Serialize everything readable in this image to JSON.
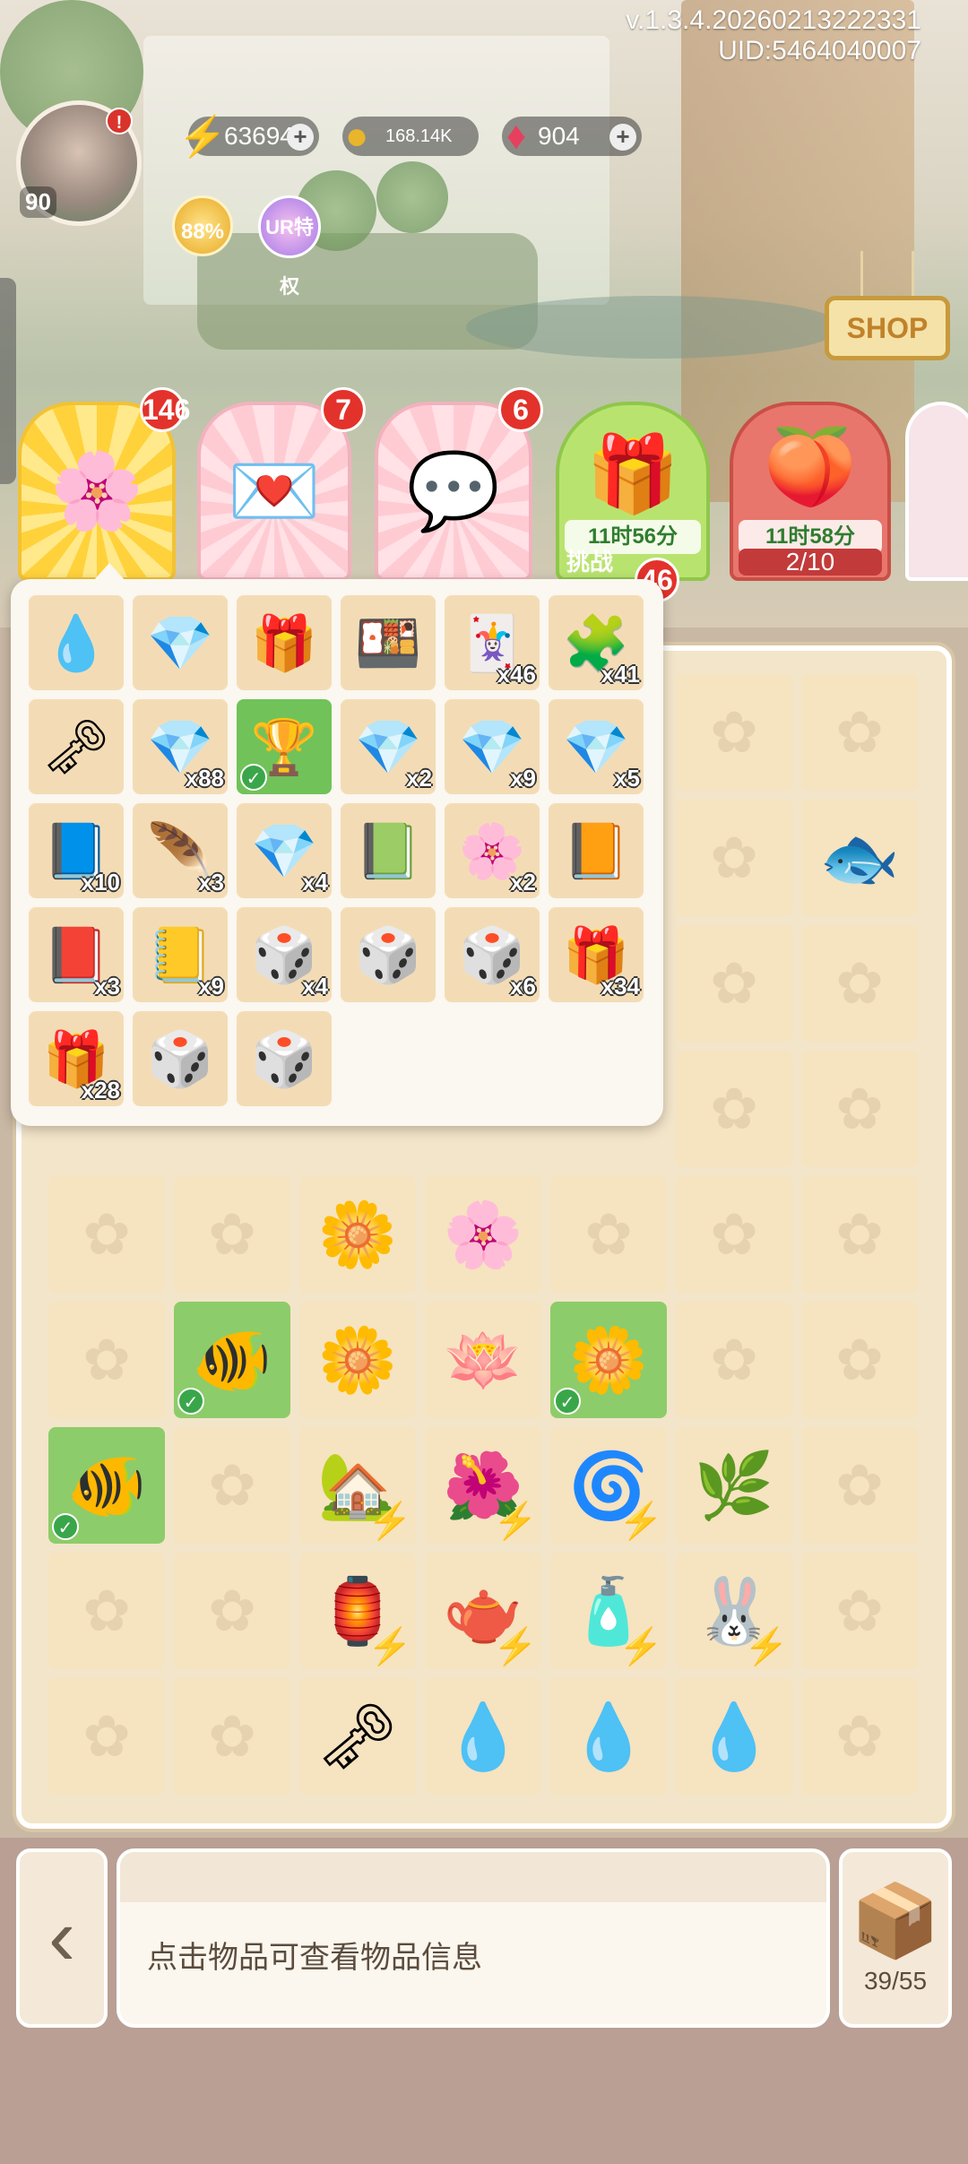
{
  "header": {
    "version": "v.1.3.4.20260213222331",
    "uid": "UID:5464040007",
    "player_level": "90",
    "avatar_alert": "!",
    "energy": "63694",
    "coins": "168.14K",
    "gems": "904",
    "up_badge": "88%",
    "ur_badge": "UR特权",
    "shop_label": "SHOP"
  },
  "events": [
    {
      "badge": "146"
    },
    {
      "badge": "7"
    },
    {
      "badge": "6"
    },
    {
      "timer": "11时56分",
      "badge": "46",
      "sub": "挑战"
    },
    {
      "timer": "11时58分",
      "energy": "2/10"
    }
  ],
  "popup": {
    "items": [
      {
        "icon": "💧",
        "qty": ""
      },
      {
        "icon": "💎",
        "qty": ""
      },
      {
        "icon": "🎁",
        "qty": ""
      },
      {
        "icon": "🍱",
        "qty": ""
      },
      {
        "icon": "🃏",
        "qty": "x46"
      },
      {
        "icon": "🧩",
        "qty": "x41"
      },
      {
        "icon": "🗝",
        "qty": ""
      },
      {
        "icon": "💎",
        "qty": "x88"
      },
      {
        "icon": "🏆",
        "qty": ""
      },
      {
        "icon": "💎",
        "qty": "x2"
      },
      {
        "icon": "💎",
        "qty": "x9"
      },
      {
        "icon": "💎",
        "qty": "x5"
      },
      {
        "icon": "📘",
        "qty": "x10"
      },
      {
        "icon": "🪶",
        "qty": "x3"
      },
      {
        "icon": "💎",
        "qty": "x4"
      },
      {
        "icon": "📗",
        "qty": ""
      },
      {
        "icon": "🌸",
        "qty": "x2"
      },
      {
        "icon": "📙",
        "qty": ""
      },
      {
        "icon": "📕",
        "qty": "x3"
      },
      {
        "icon": "📒",
        "qty": "x9"
      },
      {
        "icon": "🎲",
        "qty": "x4"
      },
      {
        "icon": "🎲",
        "qty": ""
      },
      {
        "icon": "🎲",
        "qty": "x6"
      },
      {
        "icon": "🎁",
        "qty": "x34"
      },
      {
        "icon": "🎁",
        "qty": "x28"
      },
      {
        "icon": "🎲",
        "qty": ""
      },
      {
        "icon": "🎲",
        "qty": ""
      }
    ]
  },
  "bottom": {
    "info_text": "点击物品可查看物品信息",
    "storage": "39/55"
  }
}
